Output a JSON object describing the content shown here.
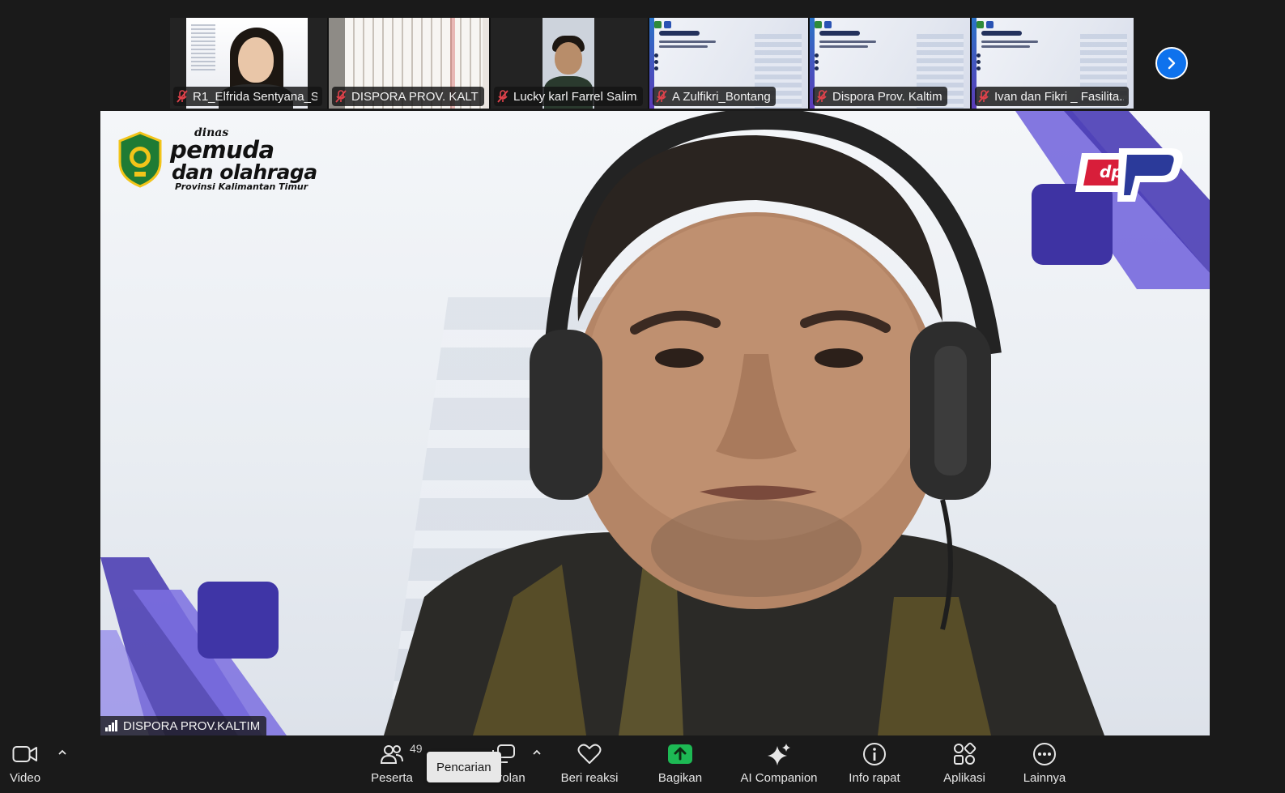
{
  "participants": [
    {
      "name": "R1_Elfrida Sentyana_S...",
      "muted": true,
      "kind": "person-female"
    },
    {
      "name": "DISPORA PROV. KALTI...",
      "muted": true,
      "kind": "room"
    },
    {
      "name": "Lucky karl Farrel Salim...",
      "muted": true,
      "kind": "person-male"
    },
    {
      "name": "A Zulfikri_Bontang",
      "muted": true,
      "kind": "slide"
    },
    {
      "name": "Dispora Prov. Kaltim",
      "muted": true,
      "kind": "slide"
    },
    {
      "name": "Ivan dan Fikri _ Fasilita...",
      "muted": true,
      "kind": "slide"
    }
  ],
  "main": {
    "speaker": "DISPORA PROV.KALTIM",
    "logo": {
      "line1": "dinas",
      "line2": "pemuda",
      "line3": "dan olahraga",
      "line4": "Provinsi Kalimantan Timur"
    },
    "brand_mark": "dp"
  },
  "toolbar": {
    "video": "Video",
    "participants": "Peserta",
    "participant_count": "49",
    "search_tooltip": "Pencarian",
    "chat": "Obrolan",
    "react": "Beri reaksi",
    "share": "Bagikan",
    "ai": "AI Companion",
    "info": "Info rapat",
    "apps": "Aplikasi",
    "more": "Lainnya"
  },
  "colors": {
    "accent_blue": "#0e72ed",
    "share_green": "#1db954",
    "mute_red": "#e0424b",
    "decor_purple": "#5b4bc4"
  },
  "icons": {
    "next": "chevron-right-icon",
    "mute": "mic-muted-icon",
    "signal": "signal-bars-icon"
  }
}
